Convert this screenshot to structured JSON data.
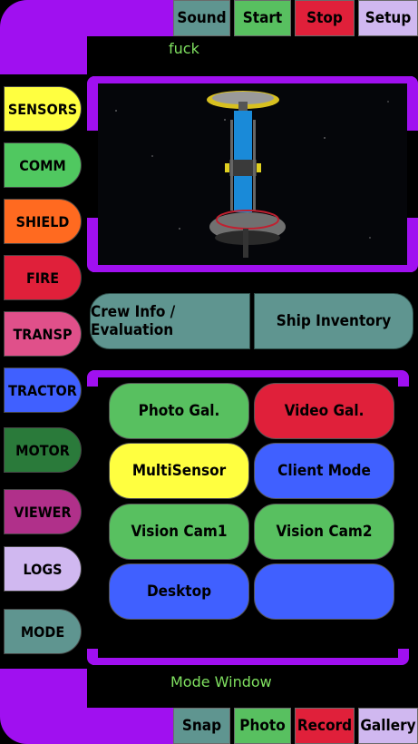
{
  "top_bar": {
    "sound": "Sound",
    "start": "Start",
    "stop": "Stop",
    "setup": "Setup"
  },
  "top_label": "fuck",
  "sidebar": [
    {
      "label": "SENSORS",
      "color": "#ffff40"
    },
    {
      "label": "COMM",
      "color": "#50c860"
    },
    {
      "label": "SHIELD",
      "color": "#ff6a20"
    },
    {
      "label": "FIRE",
      "color": "#e0203a"
    },
    {
      "label": "TRANSP",
      "color": "#e0508a"
    },
    {
      "label": "TRACTOR",
      "color": "#4060ff"
    },
    {
      "label": "MOTOR",
      "color": "#2a7a3a"
    },
    {
      "label": "VIEWER",
      "color": "#b0308a"
    },
    {
      "label": "LOGS",
      "color": "#d0b8f0"
    },
    {
      "label": "MODE",
      "color": "#5f9590"
    }
  ],
  "info_buttons": {
    "crew": "Crew Info / Evaluation",
    "inventory": "Ship Inventory"
  },
  "grid_buttons": [
    {
      "label": "Photo Gal.",
      "color": "#58c060"
    },
    {
      "label": "Video Gal.",
      "color": "#e0203a"
    },
    {
      "label": "MultiSensor",
      "color": "#ffff40"
    },
    {
      "label": "Client Mode",
      "color": "#4060ff"
    },
    {
      "label": "Vision Cam1",
      "color": "#58c060"
    },
    {
      "label": "Vision Cam2",
      "color": "#58c060"
    },
    {
      "label": "Desktop",
      "color": "#4060ff"
    },
    {
      "label": "",
      "color": "#4060ff"
    }
  ],
  "mode_label": "Mode Window",
  "bottom_bar": {
    "snap": "Snap",
    "photo": "Photo",
    "record": "Record",
    "gallery": "Gallery"
  },
  "colors": {
    "frame": "#a010f0",
    "accent_text": "#7fe060"
  }
}
